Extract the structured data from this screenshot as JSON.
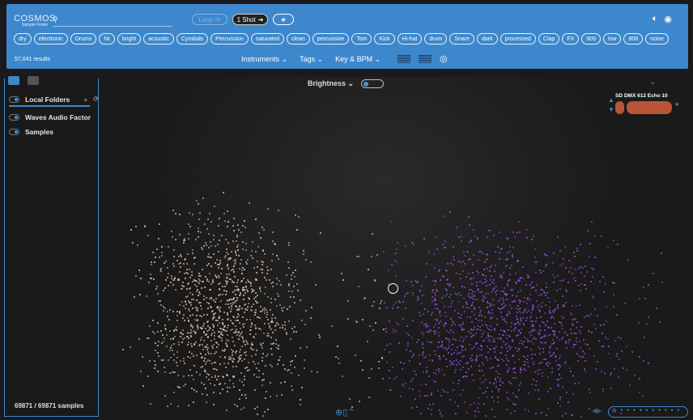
{
  "header": {
    "logo": "COSMOS",
    "logo_sub": "Sample Finder",
    "search_placeholder": "",
    "loop_label": "Loop",
    "oneshot_label": "1 Shot",
    "favorite_icon": "star-icon",
    "tags": [
      "dry",
      "electronic",
      "Drums",
      "hit",
      "bright",
      "acoustic",
      "Cymbals",
      "Percussion",
      "saturated",
      "clean",
      "percussive",
      "Tom",
      "Kick",
      "Hi-hat",
      "drum",
      "Snare",
      "dark",
      "processed",
      "Clap",
      "FX",
      "909",
      "low",
      "808",
      "noise"
    ],
    "results": "57,041 results",
    "filters": [
      "Instruments",
      "Tags",
      "Key & BPM"
    ]
  },
  "sidebar": {
    "items": [
      {
        "label": "Local Folders"
      },
      {
        "label": "Waves Audio Factor"
      },
      {
        "label": "Samples"
      }
    ],
    "count": "69871 / 69871 samples"
  },
  "map": {
    "axis_select": "Brightness",
    "colors": {
      "low": "#e8c4a8",
      "high": "#9b4fe0",
      "accent": "#3d88cc"
    }
  },
  "player": {
    "title": "SD DMX 612 Echo 10"
  }
}
